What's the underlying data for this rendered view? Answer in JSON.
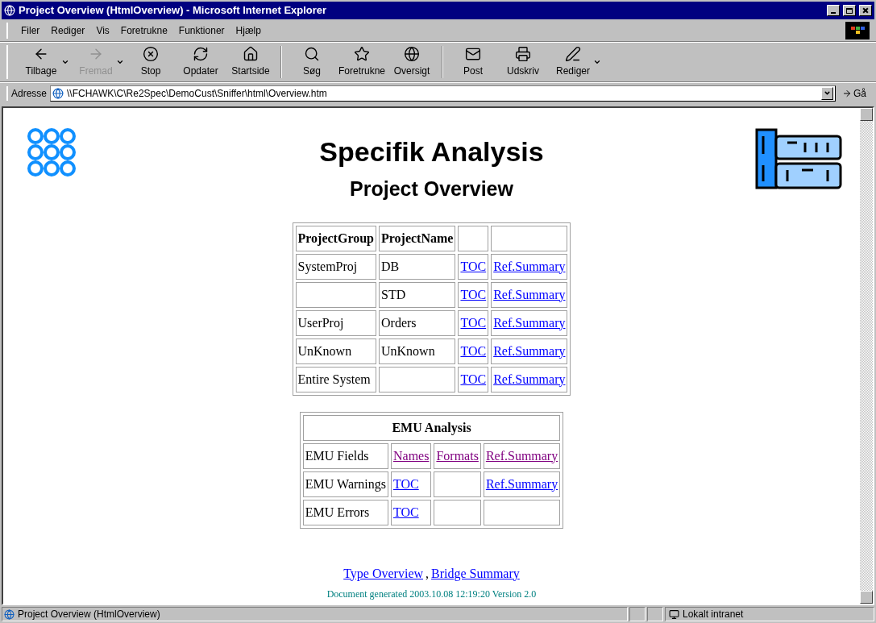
{
  "window": {
    "title": "Project Overview (HtmlOverview) - Microsoft Internet Explorer"
  },
  "menu": [
    "Filer",
    "Rediger",
    "Vis",
    "Foretrukne",
    "Funktioner",
    "Hjælp"
  ],
  "toolbar": [
    {
      "kind": "back",
      "label": "Tilbage",
      "disabled": false,
      "dropdown": true
    },
    {
      "kind": "forward",
      "label": "Fremad",
      "disabled": true,
      "dropdown": true
    },
    {
      "kind": "stop",
      "label": "Stop",
      "disabled": false,
      "dropdown": false
    },
    {
      "kind": "refresh",
      "label": "Opdater",
      "disabled": false,
      "dropdown": false
    },
    {
      "kind": "home",
      "label": "Startside",
      "disabled": false,
      "dropdown": false
    },
    {
      "kind": "search",
      "label": "Søg",
      "disabled": false,
      "dropdown": false
    },
    {
      "kind": "favorites",
      "label": "Foretrukne",
      "disabled": false,
      "dropdown": false
    },
    {
      "kind": "history",
      "label": "Oversigt",
      "disabled": false,
      "dropdown": false
    },
    {
      "kind": "mail",
      "label": "Post",
      "disabled": false,
      "dropdown": false
    },
    {
      "kind": "print",
      "label": "Udskriv",
      "disabled": false,
      "dropdown": false
    },
    {
      "kind": "edit",
      "label": "Rediger",
      "disabled": false,
      "dropdown": true
    }
  ],
  "address": {
    "label": "Adresse",
    "value": "\\\\FCHAWK\\C\\Re2Spec\\DemoCust\\Sniffer\\html\\Overview.htm",
    "go": "Gå"
  },
  "page": {
    "title": "Specifik Analysis",
    "subtitle": "Project Overview",
    "project_table": {
      "columns": [
        "ProjectGroup",
        "ProjectName"
      ],
      "rows": [
        [
          {
            "kind": "text",
            "text": "SystemProj"
          },
          {
            "kind": "text",
            "text": "DB"
          },
          {
            "kind": "link",
            "text": "TOC",
            "visited": false
          },
          {
            "kind": "link",
            "text": "Ref.Summary",
            "visited": false
          }
        ],
        [
          {
            "kind": "empty"
          },
          {
            "kind": "text",
            "text": "STD"
          },
          {
            "kind": "link",
            "text": "TOC",
            "visited": false
          },
          {
            "kind": "link",
            "text": "Ref.Summary",
            "visited": false
          }
        ],
        [
          {
            "kind": "text",
            "text": "UserProj"
          },
          {
            "kind": "text",
            "text": "Orders"
          },
          {
            "kind": "link",
            "text": "TOC",
            "visited": false
          },
          {
            "kind": "link",
            "text": "Ref.Summary",
            "visited": false
          }
        ],
        [
          {
            "kind": "text",
            "text": "UnKnown"
          },
          {
            "kind": "text",
            "text": "UnKnown"
          },
          {
            "kind": "link",
            "text": "TOC",
            "visited": false
          },
          {
            "kind": "link",
            "text": "Ref.Summary",
            "visited": false
          }
        ],
        [
          {
            "kind": "text",
            "text": "Entire System"
          },
          {
            "kind": "empty"
          },
          {
            "kind": "link",
            "text": "TOC",
            "visited": false
          },
          {
            "kind": "link",
            "text": "Ref.Summary",
            "visited": false
          }
        ]
      ]
    },
    "emu_table": {
      "title": "EMU Analysis",
      "rows": [
        [
          {
            "kind": "text",
            "text": "EMU Fields"
          },
          {
            "kind": "link",
            "text": "Names",
            "visited": true
          },
          {
            "kind": "link",
            "text": "Formats",
            "visited": true
          },
          {
            "kind": "link",
            "text": "Ref.Summary",
            "visited": true
          }
        ],
        [
          {
            "kind": "text",
            "text": "EMU Warnings"
          },
          {
            "kind": "link",
            "text": "TOC",
            "visited": false
          },
          {
            "kind": "empty"
          },
          {
            "kind": "link",
            "text": "Ref.Summary",
            "visited": false
          }
        ],
        [
          {
            "kind": "text",
            "text": "EMU Errors"
          },
          {
            "kind": "link",
            "text": "TOC",
            "visited": false
          },
          {
            "kind": "empty"
          },
          {
            "kind": "empty"
          }
        ]
      ]
    },
    "footer_links": [
      {
        "text": "Type Overview",
        "visited": false
      },
      {
        "text": "Bridge Summary",
        "visited": false
      }
    ],
    "footer_separator": ",",
    "generated": "Document generated 2003.10.08 12:19:20 Version 2.0"
  },
  "status_bar": {
    "text": "Project Overview (HtmlOverview)",
    "zone": "Lokalt intranet"
  }
}
